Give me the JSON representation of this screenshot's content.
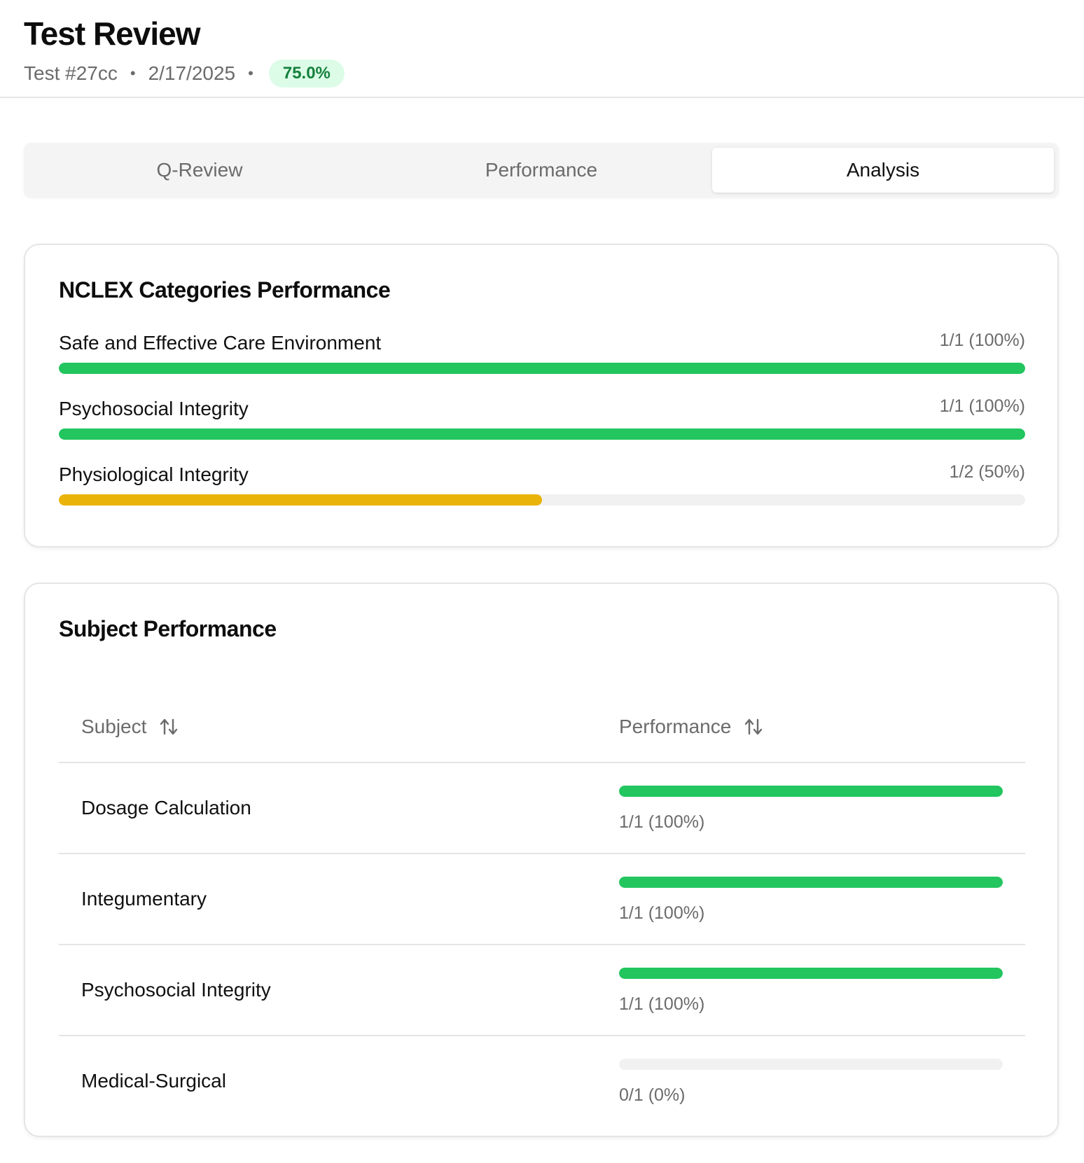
{
  "header": {
    "title": "Test Review",
    "test_id": "Test #27cc",
    "separator": "•",
    "date": "2/17/2025",
    "score": "75.0%"
  },
  "tabs": [
    {
      "label": "Q-Review",
      "active": false
    },
    {
      "label": "Performance",
      "active": false
    },
    {
      "label": "Analysis",
      "active": true
    }
  ],
  "colors": {
    "good": "#22c55e",
    "warning": "#eab308",
    "track": "#f1f1f1",
    "badge_bg": "#dcfce7",
    "badge_text": "#15803d"
  },
  "nclex": {
    "title": "NCLEX Categories Performance",
    "categories": [
      {
        "label": "Safe and Effective Care Environment",
        "value_text": "1/1 (100%)",
        "percent": 100,
        "color": "#22c55e"
      },
      {
        "label": "Psychosocial Integrity",
        "value_text": "1/1 (100%)",
        "percent": 100,
        "color": "#22c55e"
      },
      {
        "label": "Physiological Integrity",
        "value_text": "1/2 (50%)",
        "percent": 50,
        "color": "#eab308"
      }
    ]
  },
  "subjects": {
    "title": "Subject Performance",
    "columns": [
      "Subject",
      "Performance"
    ],
    "sort_icon": "sort-arrows-icon",
    "rows": [
      {
        "subject": "Dosage Calculation",
        "value_text": "1/1 (100%)",
        "percent": 100,
        "color": "#22c55e"
      },
      {
        "subject": "Integumentary",
        "value_text": "1/1 (100%)",
        "percent": 100,
        "color": "#22c55e"
      },
      {
        "subject": "Psychosocial Integrity",
        "value_text": "1/1 (100%)",
        "percent": 100,
        "color": "#22c55e"
      },
      {
        "subject": "Medical-Surgical",
        "value_text": "0/1 (0%)",
        "percent": 0,
        "color": "#22c55e"
      }
    ]
  }
}
